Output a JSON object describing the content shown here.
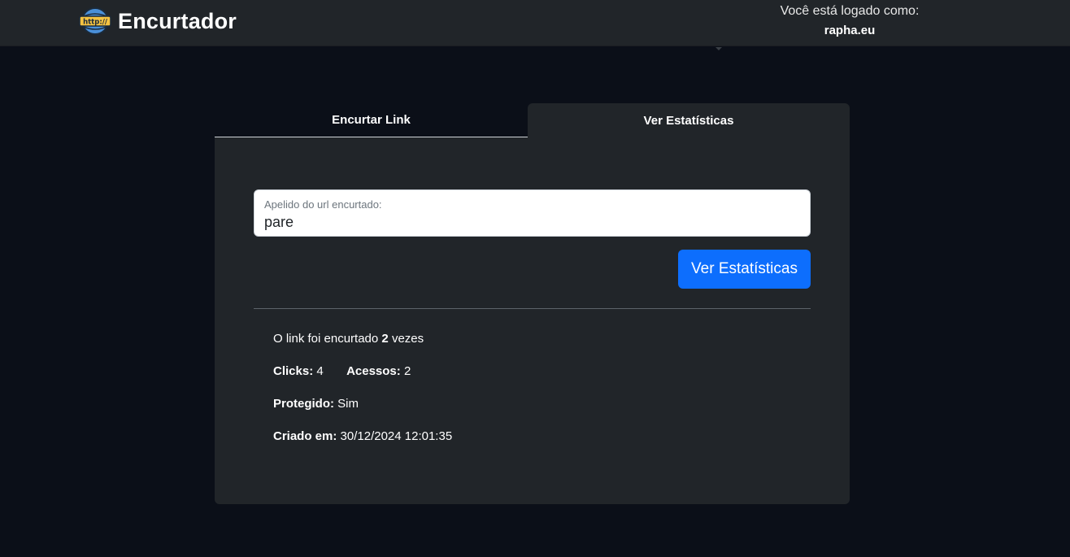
{
  "header": {
    "brand": "Encurtador",
    "logo_icon": "http-globe-icon",
    "user_caption": "Você está logado como:",
    "user_name": "rapha.eu"
  },
  "tabs": [
    {
      "label": "Encurtar Link",
      "active": false
    },
    {
      "label": "Ver Estatísticas",
      "active": true
    }
  ],
  "form": {
    "label": "Apelido do url encurtado:",
    "value": "pare",
    "submit_label": "Ver Estatísticas"
  },
  "stats": {
    "shortened_prefix": "O link foi encurtado",
    "shortened_count": "2",
    "shortened_suffix": "vezes",
    "clicks_label": "Clicks:",
    "clicks_value": "4",
    "accesses_label": "Acessos:",
    "accesses_value": "2",
    "protected_label": "Protegido:",
    "protected_value": "Sim",
    "created_label": "Criado em:",
    "created_value": "30/12/2024 12:01:35"
  },
  "colors": {
    "background": "#0b0f18",
    "surface": "#212529",
    "primary": "#0d6efd"
  }
}
